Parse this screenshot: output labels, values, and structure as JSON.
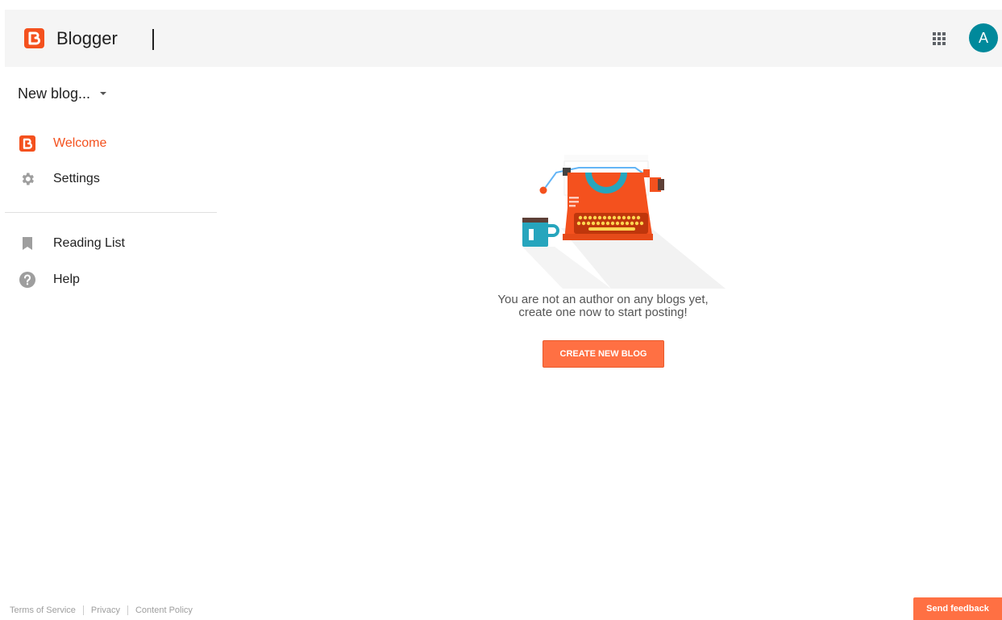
{
  "header": {
    "brand": "Blogger",
    "avatar_letter": "A"
  },
  "sidebar": {
    "blog_selector": "New blog...",
    "items": [
      {
        "label": "Welcome",
        "icon": "blogger-icon",
        "active": true
      },
      {
        "label": "Settings",
        "icon": "gear-icon",
        "active": false
      },
      {
        "label": "Reading List",
        "icon": "bookmark-icon",
        "active": false
      },
      {
        "label": "Help",
        "icon": "help-icon",
        "active": false
      }
    ]
  },
  "main": {
    "message_line1": "You are not an author on any blogs yet,",
    "message_line2": "create one now to start posting!",
    "create_button": "CREATE NEW BLOG"
  },
  "footer": {
    "links": [
      "Terms of Service",
      "Privacy",
      "Content Policy"
    ],
    "feedback_button": "Send feedback"
  },
  "colors": {
    "accent": "#f4511e",
    "button": "#ff7043",
    "avatar": "#00899b",
    "header_bg": "#f5f5f5"
  }
}
